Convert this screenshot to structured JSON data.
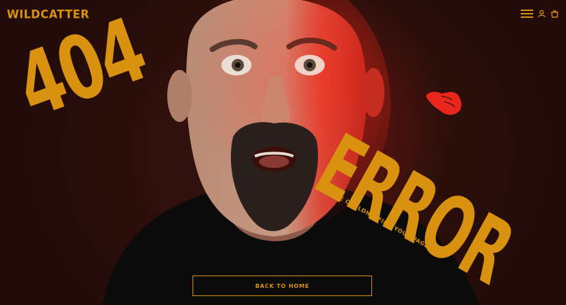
{
  "brand": {
    "logo_text": "WILDCATTER",
    "accent_color": "#d9920f"
  },
  "nav": {
    "icons": [
      "menu-icon",
      "account-icon",
      "cart-icon"
    ]
  },
  "hero": {
    "code": "404",
    "word": "ERROR",
    "tagline": "WE COULDN'T FIND YOUR PAGE",
    "decoration": "pointing-hand-icon"
  },
  "cta": {
    "back_label": "BACK TO HOME"
  },
  "colors": {
    "background": "#2a0f0b",
    "accent": "#d9920f",
    "hand": "#e8261a"
  }
}
